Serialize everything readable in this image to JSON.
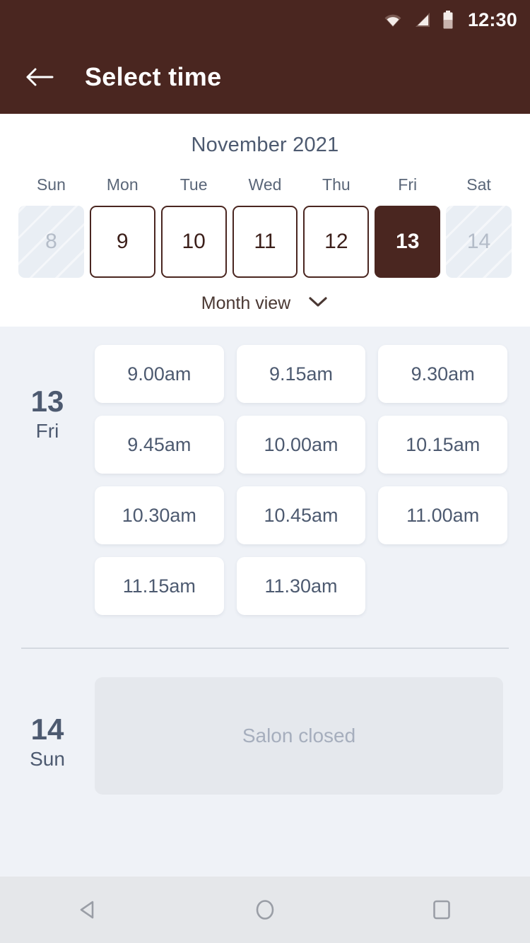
{
  "theme": {
    "brand_maroon": "#4a2620",
    "bg_gray": "#eff2f7",
    "text_slate": "#4d5a70",
    "muted": "#a6aebd",
    "navbar_bg": "#e5e7ea"
  },
  "status_bar": {
    "time": "12:30",
    "icons": [
      "wifi-icon",
      "signal-icon",
      "battery-icon"
    ]
  },
  "app_bar": {
    "back_icon": "back-arrow-icon",
    "title": "Select time"
  },
  "calendar": {
    "month_label": "November 2021",
    "day_names": [
      "Sun",
      "Mon",
      "Tue",
      "Wed",
      "Thu",
      "Fri",
      "Sat"
    ],
    "dates": [
      {
        "day": "8",
        "state": "disabled"
      },
      {
        "day": "9",
        "state": "enabled"
      },
      {
        "day": "10",
        "state": "enabled"
      },
      {
        "day": "11",
        "state": "enabled"
      },
      {
        "day": "12",
        "state": "enabled"
      },
      {
        "day": "13",
        "state": "selected"
      },
      {
        "day": "14",
        "state": "disabled"
      }
    ],
    "view_toggle": {
      "label": "Month view",
      "icon": "chevron-down-icon"
    }
  },
  "schedule": [
    {
      "date_number": "13",
      "day_name": "Fri",
      "slots": [
        "9.00am",
        "9.15am",
        "9.30am",
        "9.45am",
        "10.00am",
        "10.15am",
        "10.30am",
        "10.45am",
        "11.00am",
        "11.15am",
        "11.30am"
      ],
      "closed_message": null
    },
    {
      "date_number": "14",
      "day_name": "Sun",
      "slots": [],
      "closed_message": "Salon closed"
    }
  ],
  "nav_bar": {
    "back": "nav-back-triangle-icon",
    "home": "nav-home-circle-icon",
    "recents": "nav-recents-square-icon"
  }
}
